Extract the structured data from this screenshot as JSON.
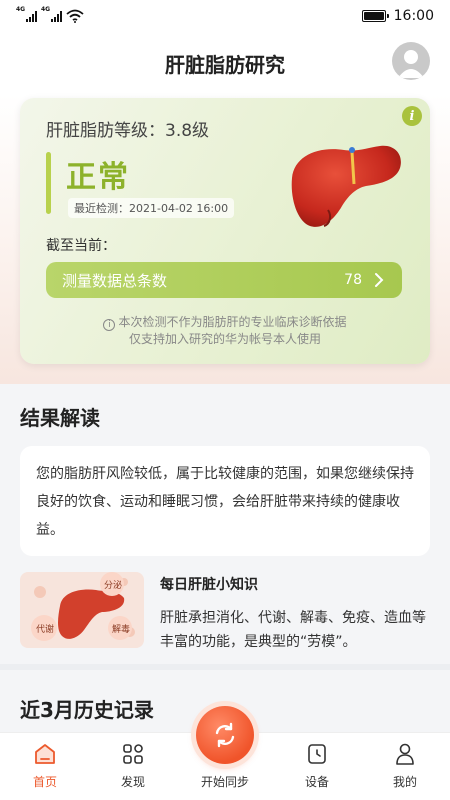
{
  "status_bar": {
    "network_1": "4G",
    "network_2": "4G",
    "time": "16:00"
  },
  "header": {
    "title": "肝脏脂肪研究"
  },
  "summary_card": {
    "level_label": "肝脏脂肪等级：3.8级",
    "status": "正常",
    "recent_check": "最近检测：2021-04-02 16:00",
    "as_of_label": "截至当前：",
    "data_count_label": "测量数据总条数",
    "data_count_value": "78",
    "disclaimer_line1": "本次检测不作为脂肪肝的专业临床诊断依据",
    "disclaimer_line2": "仅支持加入研究的华为帐号本人使用",
    "accent_color": "#a7c84f"
  },
  "interpretation": {
    "title": "结果解读",
    "text": "您的脂肪肝风险较低，属于比较健康的范围，如果您继续保持良好的饮食、运动和睡眠习惯，会给肝脏带来持续的健康收益。"
  },
  "daily_tip": {
    "title": "每日肝脏小知识",
    "text": "肝脏承担消化、代谢、解毒、免疫、造血等丰富的功能，是典型的“劳模”。",
    "image_tags": [
      "分泌",
      "代谢",
      "解毒"
    ]
  },
  "history": {
    "title": "近3月历史记录"
  },
  "tab_bar": {
    "home": "首页",
    "discover": "发现",
    "sync": "开始同步",
    "devices": "设备",
    "me": "我的",
    "active_color": "#ec5a2d"
  }
}
